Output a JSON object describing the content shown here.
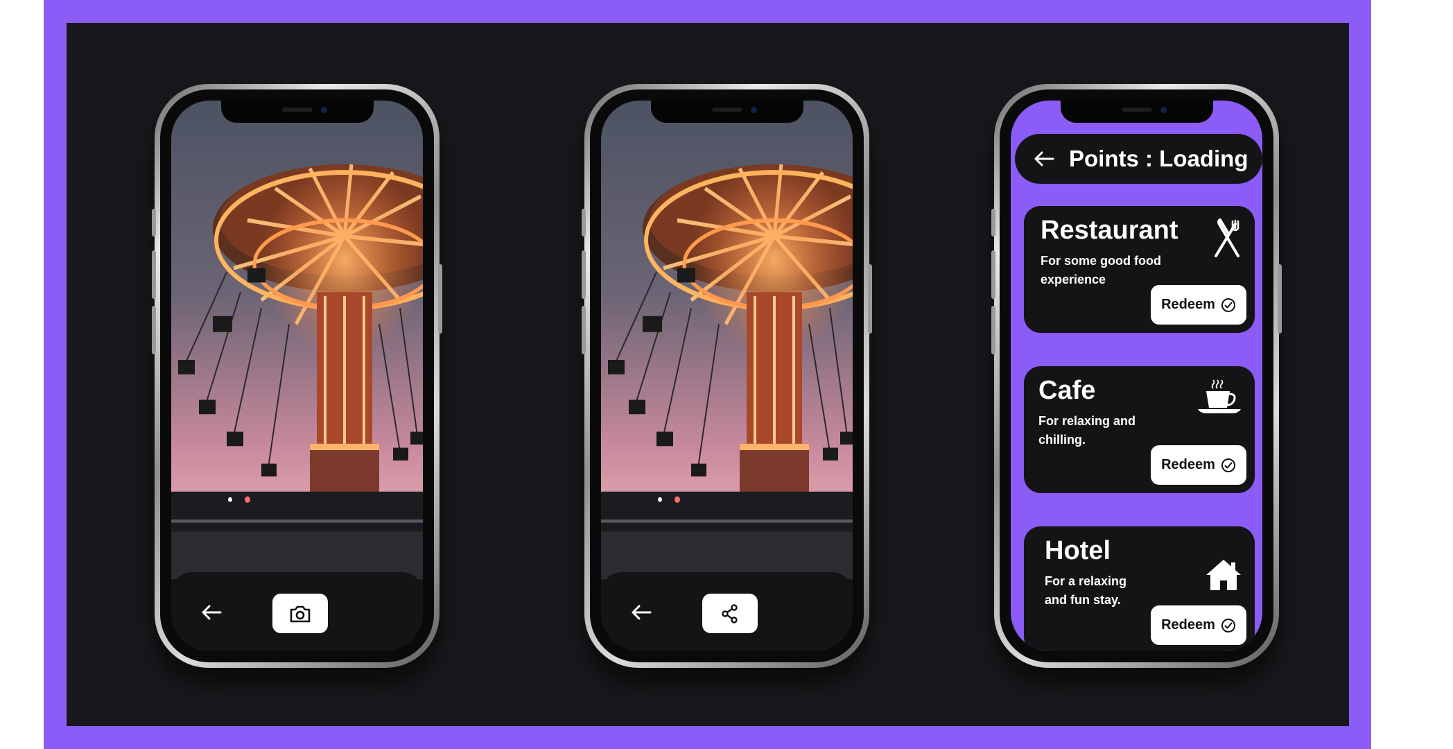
{
  "theme": {
    "accent": "#8b5cf6",
    "stage": "#18171b",
    "card": "#141417",
    "button": "#ffffff"
  },
  "phone1": {
    "back_icon": "arrow-left-icon",
    "action_icon": "camera-icon"
  },
  "phone2": {
    "back_icon": "arrow-left-icon",
    "action_icon": "share-icon"
  },
  "phone3": {
    "header": {
      "title": "Points : Loading",
      "back_icon": "arrow-left-icon"
    },
    "cards": [
      {
        "title": "Restaurant",
        "description": "For some good food experience",
        "button": "Redeem",
        "icon": "fork-knife-icon"
      },
      {
        "title": "Cafe",
        "description": "For relaxing and chilling.",
        "button": "Redeem",
        "icon": "coffee-cup-icon"
      },
      {
        "title": "Hotel",
        "description": "For a relaxing and fun stay.",
        "button": "Redeem",
        "icon": "house-icon"
      }
    ]
  }
}
